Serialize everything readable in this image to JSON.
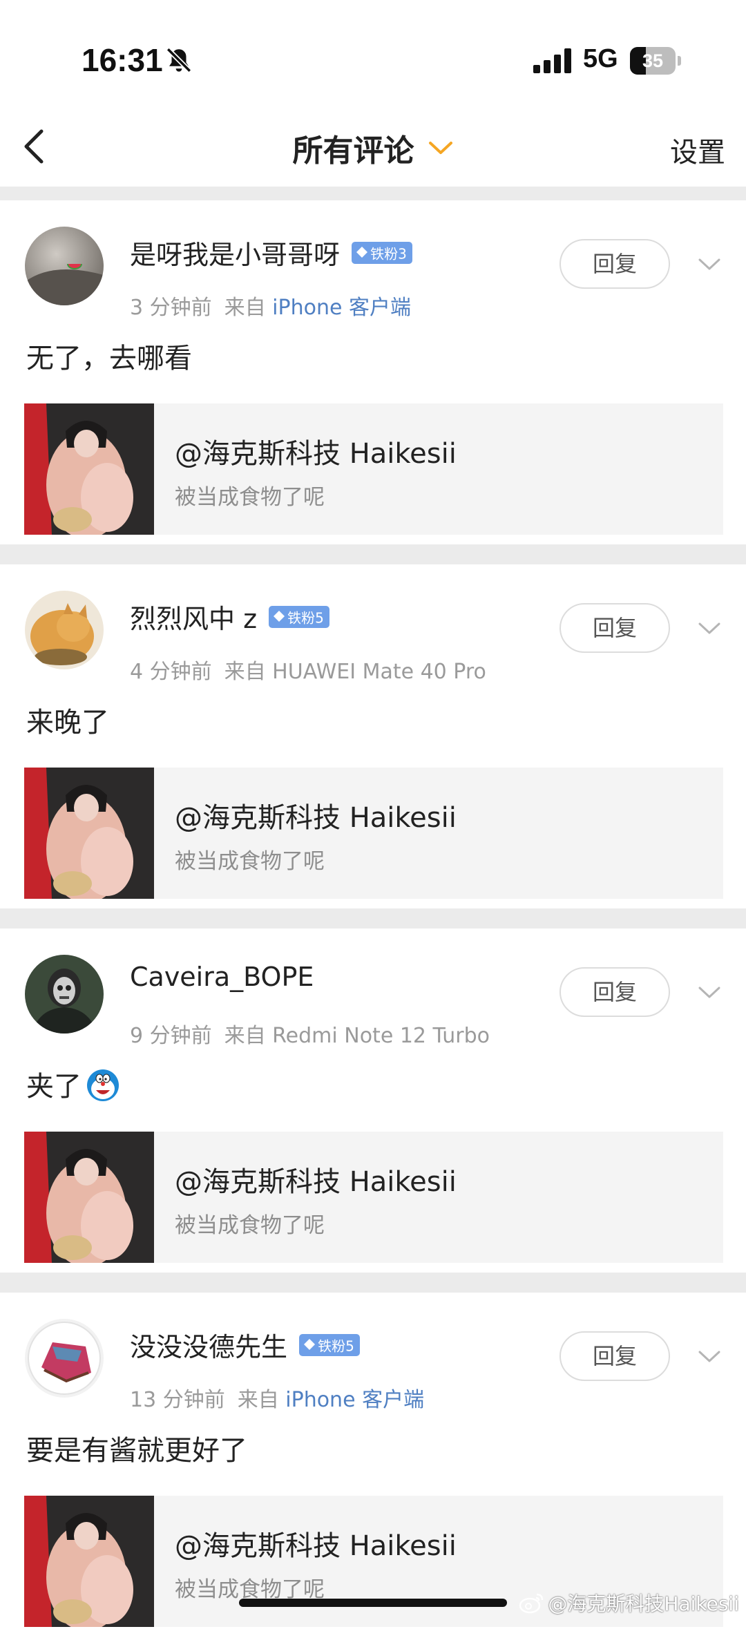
{
  "status_bar": {
    "time": "16:31",
    "network": "5G",
    "battery_level": "35",
    "battery_fraction": 0.35,
    "icons": [
      "bell-muted-icon",
      "signal-icon",
      "battery-icon"
    ]
  },
  "nav": {
    "back_icon": "chevron-left-icon",
    "title": "所有评论",
    "title_icon": "chevron-down-icon",
    "settings_label": "设置"
  },
  "colors": {
    "accent_orange": "#f5a623",
    "link_blue": "#4f7fc2",
    "badge_blue": "#6e9fe8"
  },
  "comments": [
    {
      "username": "是呀我是小哥哥呀",
      "badge": "铁粉3",
      "time": "3 分钟前",
      "source_prefix": "来自",
      "source": "iPhone 客户端",
      "source_is_link": true,
      "text": "无了，去哪看",
      "emoji": "",
      "reply_label": "回复",
      "quote_author": "@海克斯科技 Haikesii",
      "quote_text": "被当成食物了呢"
    },
    {
      "username": "烈烈风中 z",
      "badge": "铁粉5",
      "time": "4 分钟前",
      "source_prefix": "来自",
      "source": "HUAWEI Mate 40 Pro",
      "source_is_link": false,
      "text": "来晚了",
      "emoji": "",
      "reply_label": "回复",
      "quote_author": "@海克斯科技 Haikesii",
      "quote_text": "被当成食物了呢"
    },
    {
      "username": "Caveira_BOPE",
      "badge": "",
      "time": "9 分钟前",
      "source_prefix": "来自",
      "source": "Redmi Note 12 Turbo",
      "source_is_link": false,
      "text": "夹了",
      "emoji": "doraemon-emoji",
      "reply_label": "回复",
      "quote_author": "@海克斯科技 Haikesii",
      "quote_text": "被当成食物了呢"
    },
    {
      "username": "没没没德先生",
      "badge": "铁粉5",
      "time": "13 分钟前",
      "source_prefix": "来自",
      "source": "iPhone 客户端",
      "source_is_link": true,
      "text": "要是有酱就更好了",
      "emoji": "",
      "reply_label": "回复",
      "quote_author": "@海克斯科技 Haikesii",
      "quote_text": "被当成食物了呢"
    }
  ],
  "watermark": {
    "icon": "weibo-icon",
    "text": "@海克斯科技Haikesii"
  }
}
